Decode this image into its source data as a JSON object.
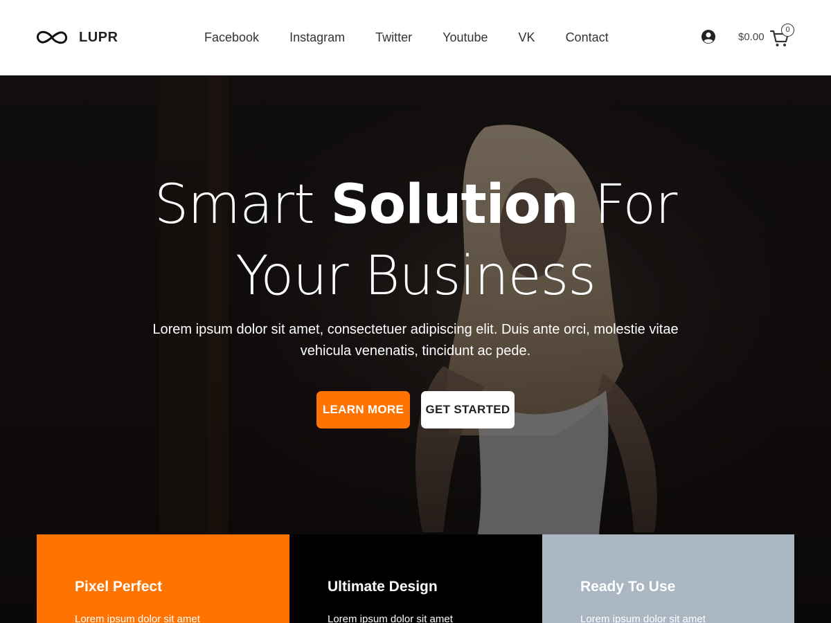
{
  "brand": {
    "name": "LUPR",
    "logo_icon": "infinity-icon"
  },
  "nav": {
    "items": [
      "Facebook",
      "Instagram",
      "Twitter",
      "Youtube",
      "VK",
      "Contact"
    ]
  },
  "header_actions": {
    "account_icon": "user-circle-icon",
    "cart_total": "$0.00",
    "cart_icon": "shopping-cart-icon",
    "cart_count": "0"
  },
  "hero": {
    "title_part1": "Smart ",
    "title_bold": "Solution",
    "title_part2": " For",
    "title_line2": "Your Business",
    "text": "Lorem ipsum dolor sit amet, consectetuer adipiscing elit. Duis ante orci, molestie vitae vehicula venenatis, tincidunt ac pede.",
    "learn_more": "LEARN MORE",
    "get_started": "GET STARTED"
  },
  "features": [
    {
      "title": "Pixel Perfect",
      "text": "Lorem ipsum dolor sit amet"
    },
    {
      "title": "Ultimate Design",
      "text": "Lorem ipsum dolor sit amet"
    },
    {
      "title": "Ready To Use",
      "text": "Lorem ipsum dolor sit amet"
    }
  ],
  "colors": {
    "accent": "#ff7300",
    "dark": "#000000",
    "muted": "#aab6c2"
  }
}
